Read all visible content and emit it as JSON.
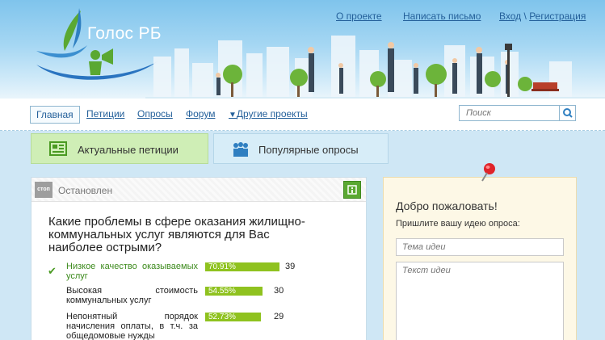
{
  "site": {
    "logo_text": "Голос РБ"
  },
  "top_links": {
    "about": "О проекте",
    "write": "Написать письмо",
    "login": "Вход",
    "separator": "\\",
    "register": "Регистрация"
  },
  "nav": {
    "items": [
      {
        "label": "Главная",
        "active": true
      },
      {
        "label": "Петиции"
      },
      {
        "label": "Опросы"
      },
      {
        "label": "Форум"
      },
      {
        "label": "Другие проекты"
      }
    ],
    "search_placeholder": "Поиск"
  },
  "tabs": {
    "petitions": "Актуальные петиции",
    "polls": "Популярные опросы"
  },
  "poll": {
    "badge": "стоп",
    "status": "Остановлен",
    "question": "Какие проблемы в сфере оказания жилищно-коммунальных услуг являются для Вас наиболее острыми?",
    "answers": [
      {
        "text": "Низкое качество оказываемых услуг",
        "percent_label": "70.91%",
        "percent": 70.91,
        "count": "39",
        "selected": true
      },
      {
        "text": "Высокая стоимость коммунальных услуг",
        "percent_label": "54.55%",
        "percent": 54.55,
        "count": "30",
        "selected": false
      },
      {
        "text": "Непонятный порядок начисления оплаты, в т.ч. за общедомовые нужды",
        "percent_label": "52.73%",
        "percent": 52.73,
        "count": "29",
        "selected": false
      }
    ]
  },
  "welcome": {
    "title": "Добро пожаловать!",
    "subtitle": "Пришлите вашу идею опроса:",
    "idea_title_placeholder": "Тема идеи",
    "idea_text_placeholder": "Текст идеи"
  },
  "colors": {
    "link": "#24609a",
    "bar": "#8fc21f",
    "accent_green": "#5aa832"
  }
}
